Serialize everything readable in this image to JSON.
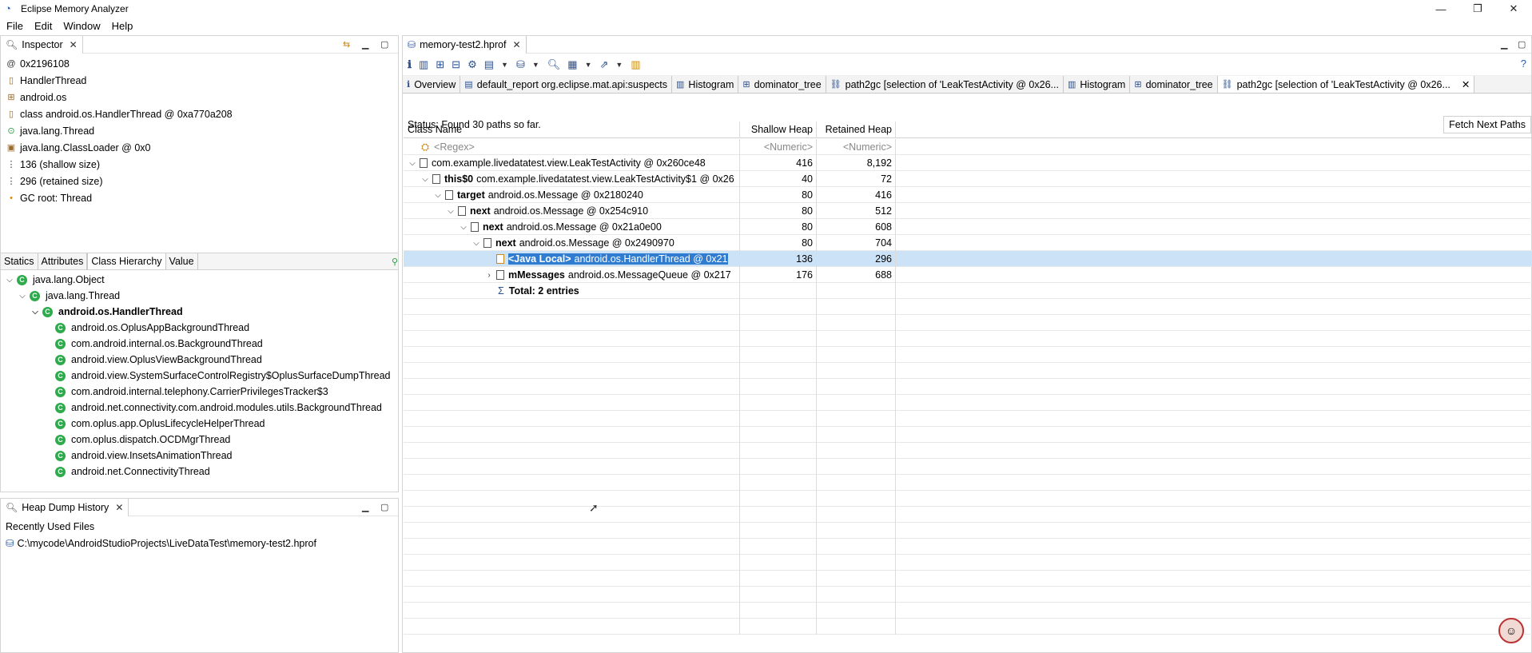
{
  "window": {
    "title": "Eclipse Memory Analyzer",
    "minimize": "—",
    "maximize": "❐",
    "close": "✕"
  },
  "menu": [
    "File",
    "Edit",
    "Window",
    "Help"
  ],
  "inspector": {
    "tab_label": "Inspector",
    "lines": [
      "0x2196108",
      "HandlerThread",
      "android.os",
      "class android.os.HandlerThread @ 0xa770a208",
      "java.lang.Thread",
      "java.lang.ClassLoader @ 0x0",
      "136 (shallow size)",
      "296 (retained size)",
      "GC root: Thread"
    ],
    "subtabs": [
      "Statics",
      "Attributes",
      "Class Hierarchy",
      "Value"
    ],
    "hierarchy": {
      "level0": "java.lang.Object",
      "level1": "java.lang.Thread",
      "level2": "android.os.HandlerThread",
      "children": [
        "android.os.OplusAppBackgroundThread",
        "com.android.internal.os.BackgroundThread",
        "android.view.OplusViewBackgroundThread",
        "android.view.SystemSurfaceControlRegistry$OplusSurfaceDumpThread",
        "com.android.internal.telephony.CarrierPrivilegesTracker$3",
        "android.net.connectivity.com.android.modules.utils.BackgroundThread",
        "com.oplus.app.OplusLifecycleHelperThread",
        "com.oplus.dispatch.OCDMgrThread",
        "android.view.InsetsAnimationThread",
        "android.net.ConnectivityThread"
      ]
    }
  },
  "history": {
    "tab_label": "Heap Dump History",
    "heading": "Recently Used Files",
    "files": [
      "C:\\mycode\\AndroidStudioProjects\\LiveDataTest\\memory-test2.hprof"
    ]
  },
  "editor": {
    "file_tab": "memory-test2.hprof",
    "tabs": [
      "Overview",
      "default_report org.eclipse.mat.api:suspects",
      "Histogram",
      "dominator_tree",
      "path2gc [selection of 'LeakTestActivity @ 0x26...",
      "Histogram",
      "dominator_tree",
      "path2gc [selection of 'LeakTestActivity @ 0x26..."
    ],
    "status": "Status:  Found 30 paths so far.",
    "fetch_button": "Fetch Next Paths",
    "columns": [
      "Class Name",
      "Shallow Heap",
      "Retained Heap"
    ],
    "filters": {
      "regex": "<Regex>",
      "numeric1": "<Numeric>",
      "numeric2": "<Numeric>"
    },
    "rows": [
      {
        "field": "",
        "cls": "com.example.livedatatest.view.LeakTestActivity @ 0x260ce48",
        "shallow": "416",
        "retained": "8,192"
      },
      {
        "field": "this$0",
        "cls": "com.example.livedatatest.view.LeakTestActivity$1 @ 0x26",
        "shallow": "40",
        "retained": "72"
      },
      {
        "field": "target",
        "cls": "android.os.Message @ 0x2180240",
        "shallow": "80",
        "retained": "416"
      },
      {
        "field": "next",
        "cls": "android.os.Message @ 0x254c910",
        "shallow": "80",
        "retained": "512"
      },
      {
        "field": "next",
        "cls": "android.os.Message @ 0x21a0e00",
        "shallow": "80",
        "retained": "608"
      },
      {
        "field": "next",
        "cls": "android.os.Message @ 0x2490970",
        "shallow": "80",
        "retained": "704"
      },
      {
        "field": "<Java Local>",
        "cls": "android.os.HandlerThread @ 0x21",
        "shallow": "136",
        "retained": "296"
      },
      {
        "field": "mMessages",
        "cls": "android.os.MessageQueue @ 0x217",
        "shallow": "176",
        "retained": "688"
      }
    ],
    "total": "Total: 2 entries"
  }
}
